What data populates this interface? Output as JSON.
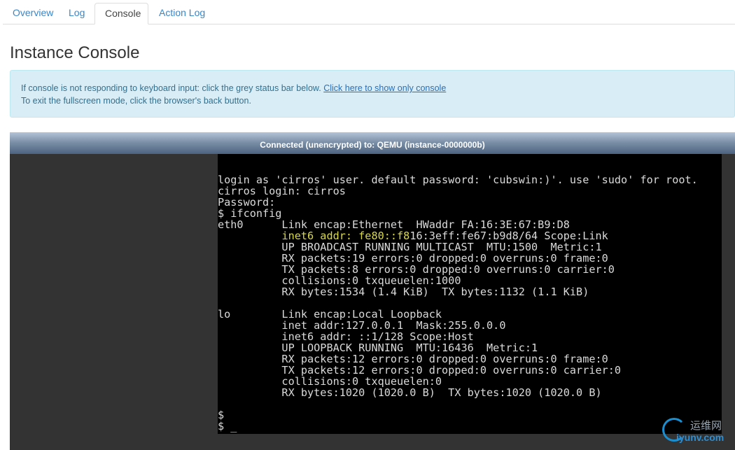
{
  "tabs": [
    {
      "label": "Overview",
      "active": false
    },
    {
      "label": "Log",
      "active": false
    },
    {
      "label": "Console",
      "active": true
    },
    {
      "label": "Action Log",
      "active": false
    }
  ],
  "page_title": "Instance Console",
  "alert": {
    "line1": "If console is not responding to keyboard input: click the grey status bar below.",
    "link": "Click here to show only console",
    "line2": "To exit the fullscreen mode, click the browser's back button."
  },
  "console": {
    "status": "Connected (unencrypted) to: QEMU (instance-0000000b)",
    "terminal": {
      "before_highlight": "login as 'cirros' user. default password: 'cubswin:)'. use 'sudo' for root.\ncirros login: cirros\nPassword: \n$ ifconfig\neth0      Link encap:Ethernet  HWaddr FA:16:3E:67:B9:D8\n          ",
      "highlight": "inet6 addr: fe80::f8",
      "after_highlight": "16:3eff:fe67:b9d8/64 Scope:Link\n          UP BROADCAST RUNNING MULTICAST  MTU:1500  Metric:1\n          RX packets:19 errors:0 dropped:0 overruns:0 frame:0\n          TX packets:8 errors:0 dropped:0 overruns:0 carrier:0\n          collisions:0 txqueuelen:1000\n          RX bytes:1534 (1.4 KiB)  TX bytes:1132 (1.1 KiB)\n\nlo        Link encap:Local Loopback\n          inet addr:127.0.0.1  Mask:255.0.0.0\n          inet6 addr: ::1/128 Scope:Host\n          UP LOOPBACK RUNNING  MTU:16436  Metric:1\n          RX packets:12 errors:0 dropped:0 overruns:0 frame:0\n          TX packets:12 errors:0 dropped:0 overruns:0 carrier:0\n          collisions:0 txqueuelen:0\n          RX bytes:1020 (1020.0 B)  TX bytes:1020 (1020.0 B)\n\n$\n$ _"
    }
  },
  "watermark": {
    "cn": "运维网",
    "url": "iyunv.com"
  }
}
